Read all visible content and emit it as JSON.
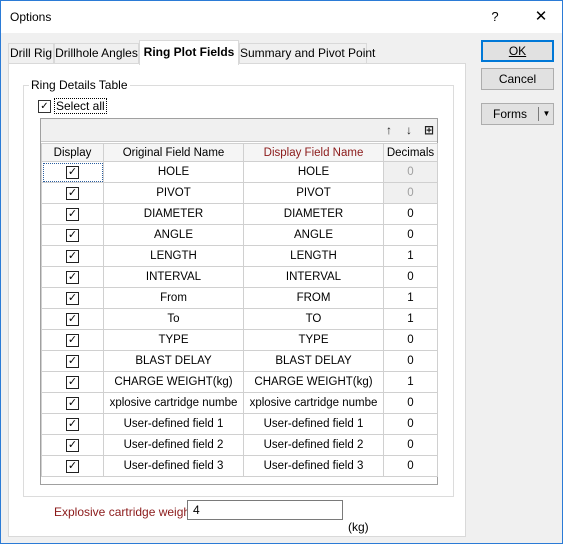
{
  "window": {
    "title": "Options",
    "help_glyph": "?",
    "close_glyph": "✕"
  },
  "tabs": [
    {
      "label": "Drill Rig"
    },
    {
      "label": "Drillhole Angles"
    },
    {
      "label": "Ring Plot Fields"
    },
    {
      "label": "Summary and Pivot Point"
    }
  ],
  "active_tab": "Ring Plot Fields",
  "ring_details": {
    "group_title": "Ring Details Table",
    "select_all_label": "Select all",
    "select_all_checked": true,
    "toolbar": {
      "move_up_icon": "↑",
      "move_down_icon": "↓",
      "insert_row_icon": "⊞"
    },
    "columns": {
      "display": "Display",
      "original": "Original Field Name",
      "display_name": "Display Field Name",
      "decimals": "Decimals"
    },
    "rows": [
      {
        "display": true,
        "original": "HOLE",
        "display_name": "HOLE",
        "decimals": "0"
      },
      {
        "display": true,
        "original": "PIVOT",
        "display_name": "PIVOT",
        "decimals": "0"
      },
      {
        "display": true,
        "original": "DIAMETER",
        "display_name": "DIAMETER",
        "decimals": "0"
      },
      {
        "display": true,
        "original": "ANGLE",
        "display_name": "ANGLE",
        "decimals": "0"
      },
      {
        "display": true,
        "original": "LENGTH",
        "display_name": "LENGTH",
        "decimals": "1"
      },
      {
        "display": true,
        "original": "INTERVAL",
        "display_name": "INTERVAL",
        "decimals": "0"
      },
      {
        "display": true,
        "original": "From",
        "display_name": "FROM",
        "decimals": "1"
      },
      {
        "display": true,
        "original": "To",
        "display_name": "TO",
        "decimals": "1"
      },
      {
        "display": true,
        "original": "TYPE",
        "display_name": "TYPE",
        "decimals": "0"
      },
      {
        "display": true,
        "original": "BLAST DELAY",
        "display_name": "BLAST DELAY",
        "decimals": "0"
      },
      {
        "display": true,
        "original": "CHARGE WEIGHT(kg)",
        "display_name": "CHARGE WEIGHT(kg)",
        "decimals": "1"
      },
      {
        "display": true,
        "original": "xplosive cartridge numbe",
        "display_name": "xplosive cartridge numbe",
        "decimals": "0"
      },
      {
        "display": true,
        "original": "User-defined field 1",
        "display_name": "User-defined field 1",
        "decimals": "0"
      },
      {
        "display": true,
        "original": "User-defined field 2",
        "display_name": "User-defined field 2",
        "decimals": "0"
      },
      {
        "display": true,
        "original": "User-defined field 3",
        "display_name": "User-defined field 3",
        "decimals": "0"
      }
    ]
  },
  "explosive_weight": {
    "label": "Explosive cartridge weight",
    "value": "4",
    "unit": "(kg)"
  },
  "buttons": {
    "ok": "OK",
    "cancel": "Cancel",
    "forms": "Forms",
    "forms_arrow": "▼"
  },
  "colors": {
    "accent": "#0078d7",
    "required_label": "#8b1a1a",
    "disabled_text": "#a0a0a0"
  }
}
